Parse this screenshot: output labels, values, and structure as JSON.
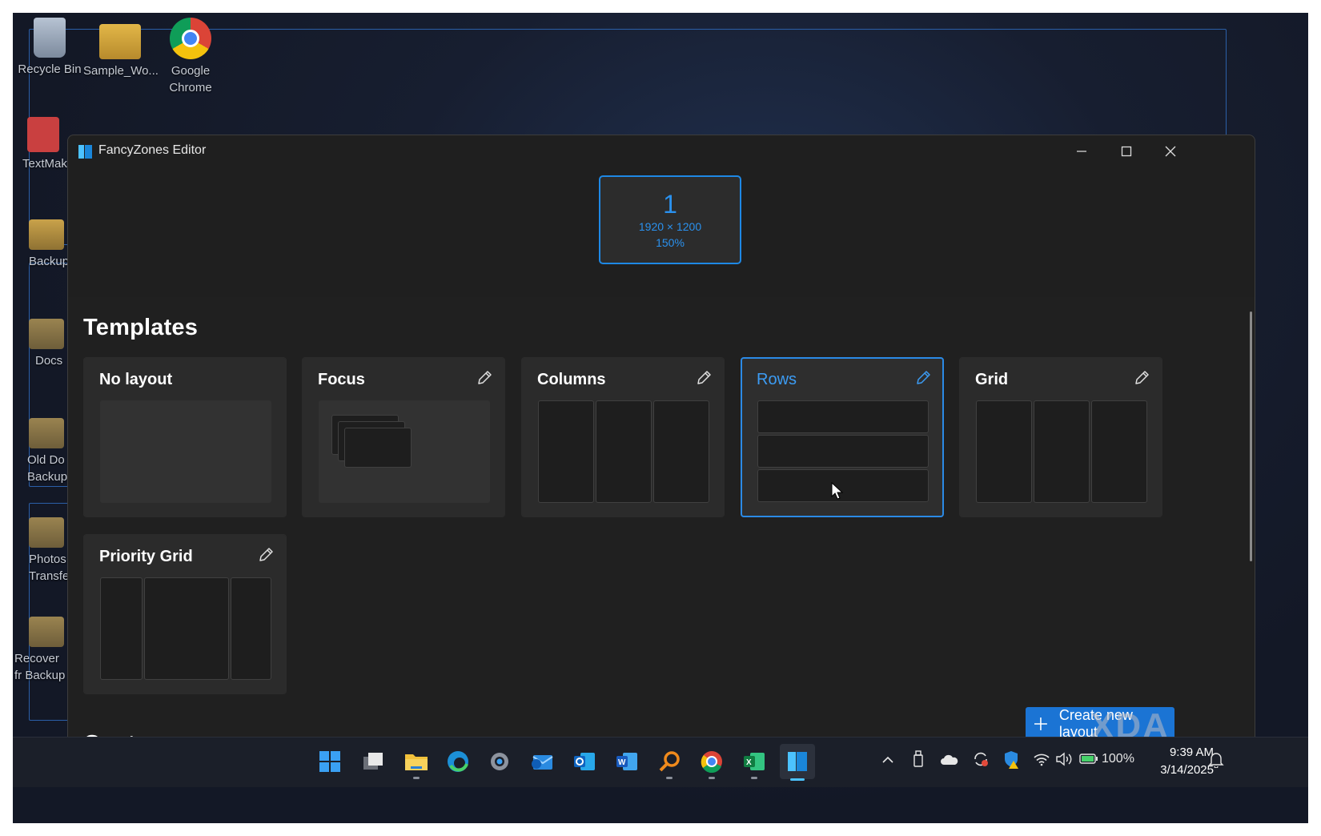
{
  "desktop": {
    "icons": [
      {
        "label": "Recycle Bin",
        "icon": "recycle-bin-icon"
      },
      {
        "label": "Sample_Wo...",
        "icon": "folder-icon"
      },
      {
        "label": "Google Chrome",
        "icon": "chrome-icon"
      },
      {
        "label": "TextMak",
        "icon": "textmaker-icon"
      },
      {
        "label": "Backup",
        "icon": "folder-icon"
      },
      {
        "label": "Docs",
        "icon": "folder-icon"
      },
      {
        "label": "Old Do Backup",
        "icon": "folder-icon"
      },
      {
        "label": "Photos Transfe",
        "icon": "folder-icon"
      },
      {
        "label": "Recover fr Backup",
        "icon": "folder-icon"
      }
    ]
  },
  "window": {
    "title": "FancyZones Editor",
    "controls": {
      "minimize": "minimize-icon",
      "maximize": "maximize-icon",
      "close": "close-icon"
    }
  },
  "monitor": {
    "number": "1",
    "resolution": "1920 × 1200",
    "scale": "150%"
  },
  "templates": {
    "heading": "Templates",
    "cards": [
      {
        "name": "No layout",
        "editable": false,
        "selected": false
      },
      {
        "name": "Focus",
        "editable": true,
        "selected": false
      },
      {
        "name": "Columns",
        "editable": true,
        "selected": false
      },
      {
        "name": "Rows",
        "editable": true,
        "selected": true
      },
      {
        "name": "Grid",
        "editable": true,
        "selected": false
      },
      {
        "name": "Priority Grid",
        "editable": true,
        "selected": false
      }
    ]
  },
  "custom": {
    "heading": "Custom"
  },
  "create_button": {
    "label": "Create new layout",
    "icon": "plus-icon"
  },
  "taskbar": {
    "apps": [
      "start-icon",
      "task-view-icon",
      "file-explorer-icon",
      "edge-icon",
      "settings-icon",
      "outlook-new-icon",
      "outlook-icon",
      "word-icon",
      "search-app-icon",
      "chrome-icon",
      "excel-icon",
      "fancyzones-icon"
    ],
    "tray": {
      "battery": "100%",
      "time": "9:39 AM",
      "date": "3/14/2025"
    }
  },
  "watermark": "XDA",
  "colors": {
    "accent": "#1e88e5",
    "window_bg": "#202020",
    "card_bg": "#2b2b2b"
  }
}
